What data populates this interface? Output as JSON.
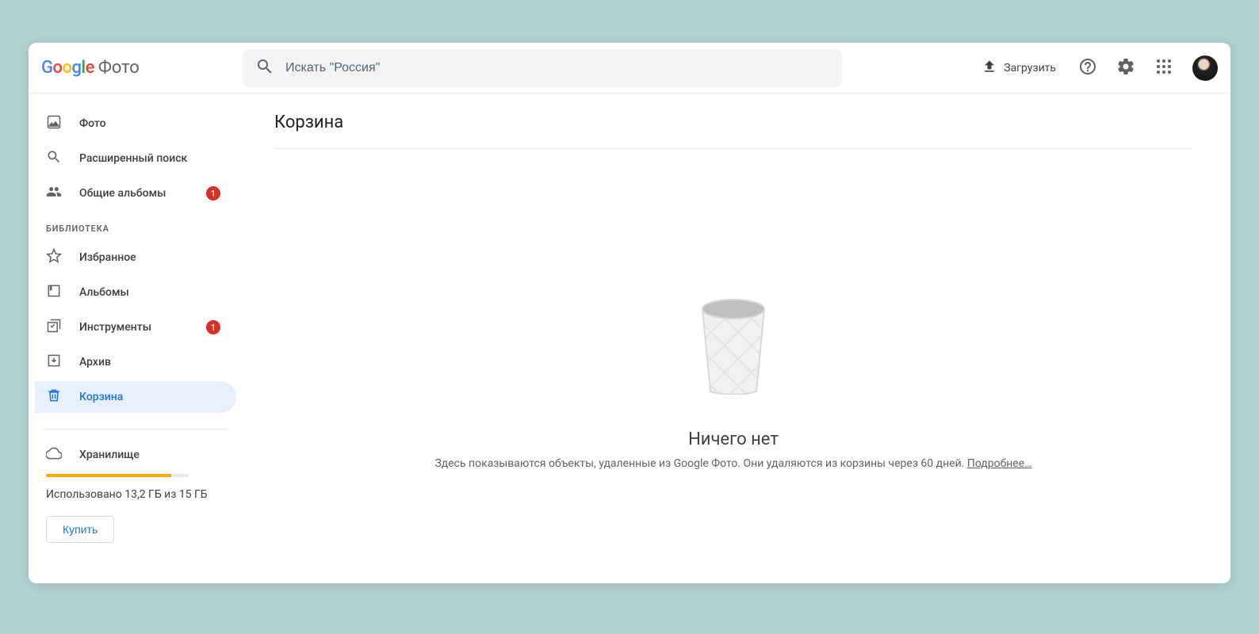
{
  "header": {
    "app_name": "Фото",
    "search_placeholder": "Искать \"Россия\"",
    "upload_label": "Загрузить"
  },
  "sidebar": {
    "items": [
      {
        "label": "Фото",
        "icon": "photo"
      },
      {
        "label": "Расширенный поиск",
        "icon": "search"
      },
      {
        "label": "Общие альбомы",
        "icon": "shared",
        "badge": "1"
      }
    ],
    "section_label": "БИБЛИОТЕКА",
    "library": [
      {
        "label": "Избранное",
        "icon": "star"
      },
      {
        "label": "Альбомы",
        "icon": "album"
      },
      {
        "label": "Инструменты",
        "icon": "utilities",
        "badge": "1"
      },
      {
        "label": "Архив",
        "icon": "archive"
      },
      {
        "label": "Корзина",
        "icon": "trash",
        "active": true
      }
    ],
    "storage": {
      "label": "Хранилище",
      "used_text": "Использовано 13,2 ГБ из 15 ГБ",
      "percent": 88,
      "buy_label": "Купить"
    }
  },
  "main": {
    "title": "Корзина",
    "empty_title": "Ничего нет",
    "empty_desc": "Здесь показываются объекты, удаленные из Google Фото. Они удаляются из корзины через 60 дней. ",
    "empty_link": "Подробнее…"
  }
}
